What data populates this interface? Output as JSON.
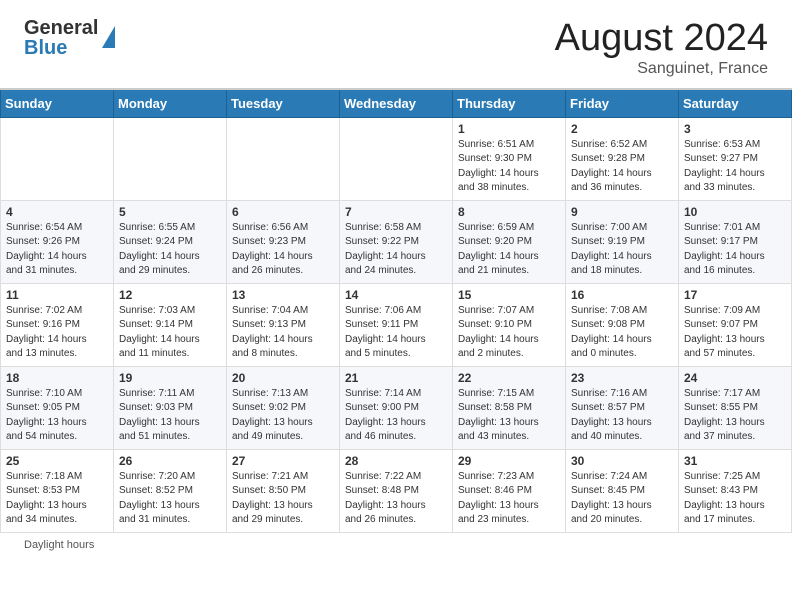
{
  "header": {
    "logo_line1": "General",
    "logo_line2": "Blue",
    "month_year": "August 2024",
    "location": "Sanguinet, France"
  },
  "days_of_week": [
    "Sunday",
    "Monday",
    "Tuesday",
    "Wednesday",
    "Thursday",
    "Friday",
    "Saturday"
  ],
  "weeks": [
    [
      {
        "day": "",
        "info": ""
      },
      {
        "day": "",
        "info": ""
      },
      {
        "day": "",
        "info": ""
      },
      {
        "day": "",
        "info": ""
      },
      {
        "day": "1",
        "info": "Sunrise: 6:51 AM\nSunset: 9:30 PM\nDaylight: 14 hours\nand 38 minutes."
      },
      {
        "day": "2",
        "info": "Sunrise: 6:52 AM\nSunset: 9:28 PM\nDaylight: 14 hours\nand 36 minutes."
      },
      {
        "day": "3",
        "info": "Sunrise: 6:53 AM\nSunset: 9:27 PM\nDaylight: 14 hours\nand 33 minutes."
      }
    ],
    [
      {
        "day": "4",
        "info": "Sunrise: 6:54 AM\nSunset: 9:26 PM\nDaylight: 14 hours\nand 31 minutes."
      },
      {
        "day": "5",
        "info": "Sunrise: 6:55 AM\nSunset: 9:24 PM\nDaylight: 14 hours\nand 29 minutes."
      },
      {
        "day": "6",
        "info": "Sunrise: 6:56 AM\nSunset: 9:23 PM\nDaylight: 14 hours\nand 26 minutes."
      },
      {
        "day": "7",
        "info": "Sunrise: 6:58 AM\nSunset: 9:22 PM\nDaylight: 14 hours\nand 24 minutes."
      },
      {
        "day": "8",
        "info": "Sunrise: 6:59 AM\nSunset: 9:20 PM\nDaylight: 14 hours\nand 21 minutes."
      },
      {
        "day": "9",
        "info": "Sunrise: 7:00 AM\nSunset: 9:19 PM\nDaylight: 14 hours\nand 18 minutes."
      },
      {
        "day": "10",
        "info": "Sunrise: 7:01 AM\nSunset: 9:17 PM\nDaylight: 14 hours\nand 16 minutes."
      }
    ],
    [
      {
        "day": "11",
        "info": "Sunrise: 7:02 AM\nSunset: 9:16 PM\nDaylight: 14 hours\nand 13 minutes."
      },
      {
        "day": "12",
        "info": "Sunrise: 7:03 AM\nSunset: 9:14 PM\nDaylight: 14 hours\nand 11 minutes."
      },
      {
        "day": "13",
        "info": "Sunrise: 7:04 AM\nSunset: 9:13 PM\nDaylight: 14 hours\nand 8 minutes."
      },
      {
        "day": "14",
        "info": "Sunrise: 7:06 AM\nSunset: 9:11 PM\nDaylight: 14 hours\nand 5 minutes."
      },
      {
        "day": "15",
        "info": "Sunrise: 7:07 AM\nSunset: 9:10 PM\nDaylight: 14 hours\nand 2 minutes."
      },
      {
        "day": "16",
        "info": "Sunrise: 7:08 AM\nSunset: 9:08 PM\nDaylight: 14 hours\nand 0 minutes."
      },
      {
        "day": "17",
        "info": "Sunrise: 7:09 AM\nSunset: 9:07 PM\nDaylight: 13 hours\nand 57 minutes."
      }
    ],
    [
      {
        "day": "18",
        "info": "Sunrise: 7:10 AM\nSunset: 9:05 PM\nDaylight: 13 hours\nand 54 minutes."
      },
      {
        "day": "19",
        "info": "Sunrise: 7:11 AM\nSunset: 9:03 PM\nDaylight: 13 hours\nand 51 minutes."
      },
      {
        "day": "20",
        "info": "Sunrise: 7:13 AM\nSunset: 9:02 PM\nDaylight: 13 hours\nand 49 minutes."
      },
      {
        "day": "21",
        "info": "Sunrise: 7:14 AM\nSunset: 9:00 PM\nDaylight: 13 hours\nand 46 minutes."
      },
      {
        "day": "22",
        "info": "Sunrise: 7:15 AM\nSunset: 8:58 PM\nDaylight: 13 hours\nand 43 minutes."
      },
      {
        "day": "23",
        "info": "Sunrise: 7:16 AM\nSunset: 8:57 PM\nDaylight: 13 hours\nand 40 minutes."
      },
      {
        "day": "24",
        "info": "Sunrise: 7:17 AM\nSunset: 8:55 PM\nDaylight: 13 hours\nand 37 minutes."
      }
    ],
    [
      {
        "day": "25",
        "info": "Sunrise: 7:18 AM\nSunset: 8:53 PM\nDaylight: 13 hours\nand 34 minutes."
      },
      {
        "day": "26",
        "info": "Sunrise: 7:20 AM\nSunset: 8:52 PM\nDaylight: 13 hours\nand 31 minutes."
      },
      {
        "day": "27",
        "info": "Sunrise: 7:21 AM\nSunset: 8:50 PM\nDaylight: 13 hours\nand 29 minutes."
      },
      {
        "day": "28",
        "info": "Sunrise: 7:22 AM\nSunset: 8:48 PM\nDaylight: 13 hours\nand 26 minutes."
      },
      {
        "day": "29",
        "info": "Sunrise: 7:23 AM\nSunset: 8:46 PM\nDaylight: 13 hours\nand 23 minutes."
      },
      {
        "day": "30",
        "info": "Sunrise: 7:24 AM\nSunset: 8:45 PM\nDaylight: 13 hours\nand 20 minutes."
      },
      {
        "day": "31",
        "info": "Sunrise: 7:25 AM\nSunset: 8:43 PM\nDaylight: 13 hours\nand 17 minutes."
      }
    ]
  ],
  "footer": {
    "daylight_hours_label": "Daylight hours"
  }
}
